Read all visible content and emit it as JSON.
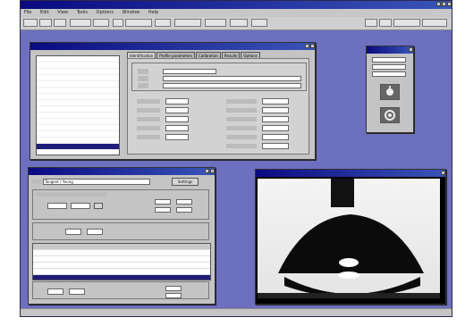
{
  "app": {
    "title": "",
    "menu": [
      "File",
      "Edit",
      "View",
      "Tools",
      "Options",
      "Window",
      "Help"
    ]
  },
  "profile_window": {
    "tabs": [
      "Identification",
      "Profile parameters",
      "Calibration",
      "Results",
      "Options"
    ],
    "list_items": [
      "",
      "",
      "",
      "",
      "",
      "",
      "",
      "",
      "",
      "",
      "",
      "",
      "",
      "",
      "",
      "",
      "",
      ""
    ],
    "selected_index": 14
  },
  "analysis_window": {
    "method_value": "Tangent / Young",
    "button_label": "Settings"
  },
  "table": {
    "headers": [
      "",
      "",
      "",
      "",
      ""
    ],
    "rows": [
      [
        "",
        "",
        "",
        "",
        ""
      ],
      [
        "",
        "",
        "",
        "",
        ""
      ],
      [
        "",
        "",
        "",
        "",
        ""
      ],
      [
        "",
        "",
        "",
        "",
        ""
      ],
      [
        "",
        "",
        "",
        "",
        ""
      ]
    ],
    "selected_row": 4
  },
  "image_window": {
    "title": ""
  },
  "colors": {
    "desktop": "#6d6fbf",
    "titlebar": "#0a0a80",
    "selection": "#1e1e7a",
    "pointer": "#1d4bb5"
  }
}
